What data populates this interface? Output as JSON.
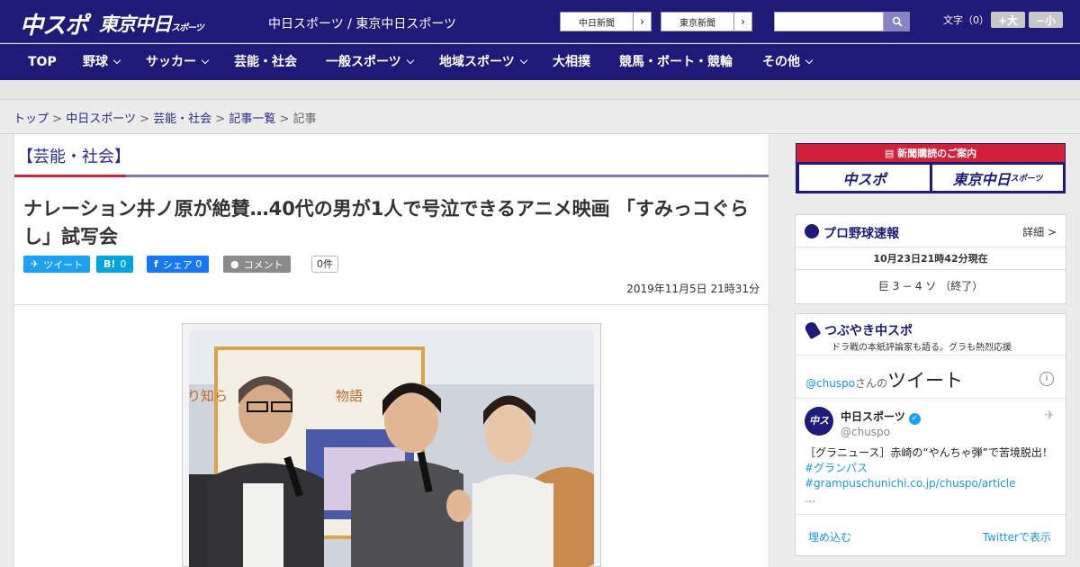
{
  "header": {
    "logo_main": "中スポ",
    "logo_tokyo": "東京中日",
    "logo_tokyo_small": "スポーツ",
    "tagline": "中日スポーツ / 東京中日スポーツ",
    "paper_links": [
      "中日新聞",
      "東京新聞"
    ],
    "search_placeholder": "",
    "font_size_label": "文字（0）",
    "font_larger": "+大",
    "font_smaller": "−小"
  },
  "nav": [
    {
      "label": "TOP",
      "dropdown": false
    },
    {
      "label": "野球",
      "dropdown": true
    },
    {
      "label": "サッカー",
      "dropdown": true
    },
    {
      "label": "芸能・社会",
      "dropdown": false
    },
    {
      "label": "一般スポーツ",
      "dropdown": true
    },
    {
      "label": "地域スポーツ",
      "dropdown": true
    },
    {
      "label": "大相撲",
      "dropdown": false
    },
    {
      "label": "競馬・ボート・競輪",
      "dropdown": false
    },
    {
      "label": "その他",
      "dropdown": true
    }
  ],
  "breadcrumb": {
    "links": [
      "トップ",
      "中日スポーツ",
      "芸能・社会",
      "記事一覧"
    ],
    "separator": ">",
    "current": "記事"
  },
  "article": {
    "section": "【芸能・社会】",
    "title": "ナレーション井ノ原が絶賛…40代の男が1人で号泣できるアニメ映画 「すみっコぐらし」試写会",
    "share": {
      "tweet": "ツイート",
      "hatena": "B!",
      "hatena_count": "0",
      "facebook": "シェア",
      "facebook_count": "0",
      "comment": "コメント",
      "comment_count": "0件"
    },
    "date": "2019年11月5日 21時31分",
    "photo_banner_text": "り知ら　　　　　　　　物語"
  },
  "sidebar": {
    "subscribe_title": "新聞購読のご案内",
    "subscribe_buttons": [
      "中スポ",
      "東京中日"
    ],
    "subscribe_button_small": "スポーツ",
    "baseball": {
      "title": "プロ野球速報",
      "more": "詳細 >",
      "updated": "10月23日21時42分現在",
      "score": "巨 3 − 4 ソ （終了）"
    },
    "tweets": {
      "title": "つぶやき中スポ",
      "subtitle": "ドラ戦の本紙評論家も語る。グラも熱烈応援",
      "account": "@chuspo",
      "account_suffix": "さんの",
      "tweets_word": "ツイート",
      "info": "i",
      "user_name": "中日スポーツ",
      "user_handle": "@chuspo",
      "avatar_text": "中スポ",
      "tweet_text": "［グラニュース］赤崎の“やんちゃ弾”で苦境脱出！",
      "tweet_links": "#グランパス #grampuschunichi.co.jp/chuspo/article",
      "tweet_ellipsis": "…",
      "embed": "埋め込む",
      "view_on": "Twitterで表示"
    }
  },
  "colors": {
    "brand_navy": "#1f1a78",
    "accent_red": "#d0213c",
    "twitter_blue": "#1da1f2",
    "facebook_blue": "#1877f2",
    "hatena_blue": "#00a4de"
  }
}
